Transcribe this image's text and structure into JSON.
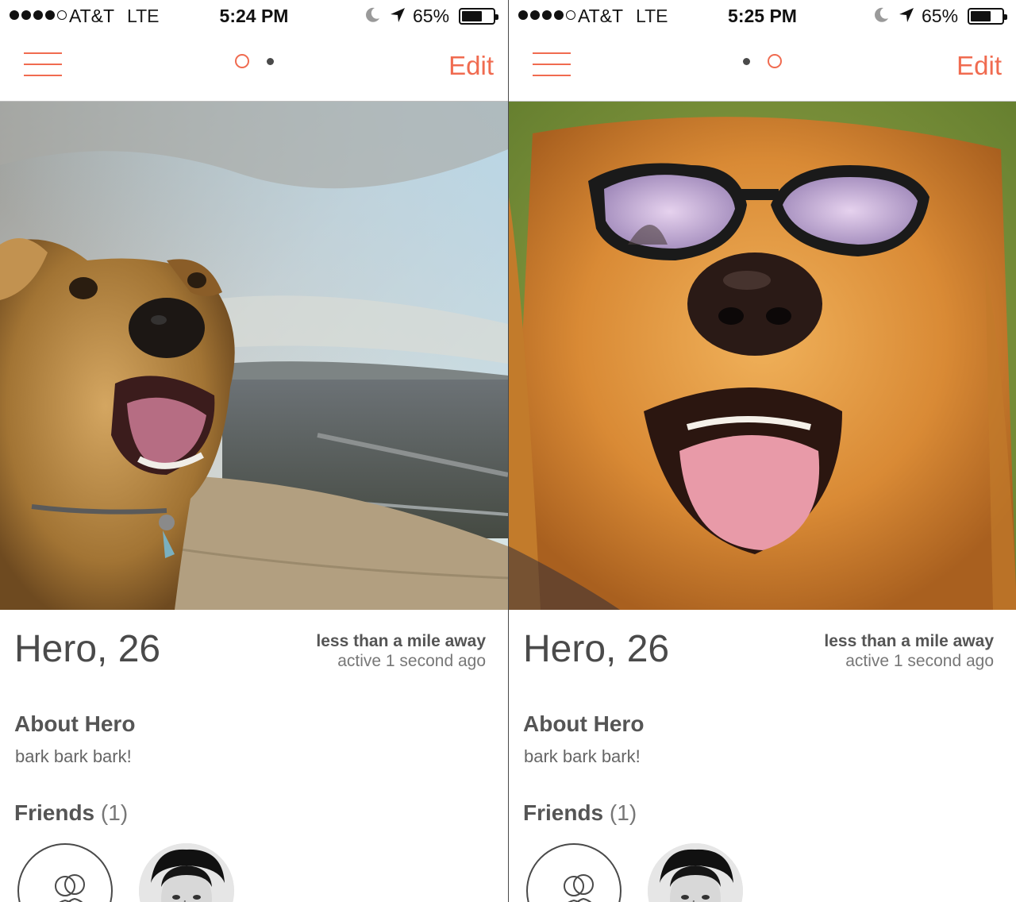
{
  "screens": [
    {
      "status": {
        "carrier": "AT&T",
        "network": "LTE",
        "time": "5:24 PM",
        "battery_pct": "65%",
        "battery_level": 0.65
      },
      "pager": {
        "active_index": 0,
        "count": 2
      },
      "nav": {
        "edit_label": "Edit",
        "menu_icon": "hamburger-menu-icon"
      },
      "photo": {
        "subject": "dog-on-hilltop-photo"
      },
      "profile": {
        "name": "Hero,",
        "age": "26",
        "distance": "less than a mile away",
        "active": "active 1 second ago",
        "about_title": "About Hero",
        "about_text": "bark bark bark!",
        "friends_title": "Friends",
        "friends_count": "(1)"
      }
    },
    {
      "status": {
        "carrier": "AT&T",
        "network": "LTE",
        "time": "5:25 PM",
        "battery_pct": "65%",
        "battery_level": 0.65
      },
      "pager": {
        "active_index": 1,
        "count": 2
      },
      "nav": {
        "edit_label": "Edit",
        "menu_icon": "hamburger-menu-icon"
      },
      "photo": {
        "subject": "dog-with-sunglasses-photo"
      },
      "profile": {
        "name": "Hero,",
        "age": "26",
        "distance": "less than a mile away",
        "active": "active 1 second ago",
        "about_title": "About Hero",
        "about_text": "bark bark bark!",
        "friends_title": "Friends",
        "friends_count": "(1)"
      }
    }
  ],
  "colors": {
    "accent": "#f06b50",
    "text": "#4a4a4a"
  }
}
